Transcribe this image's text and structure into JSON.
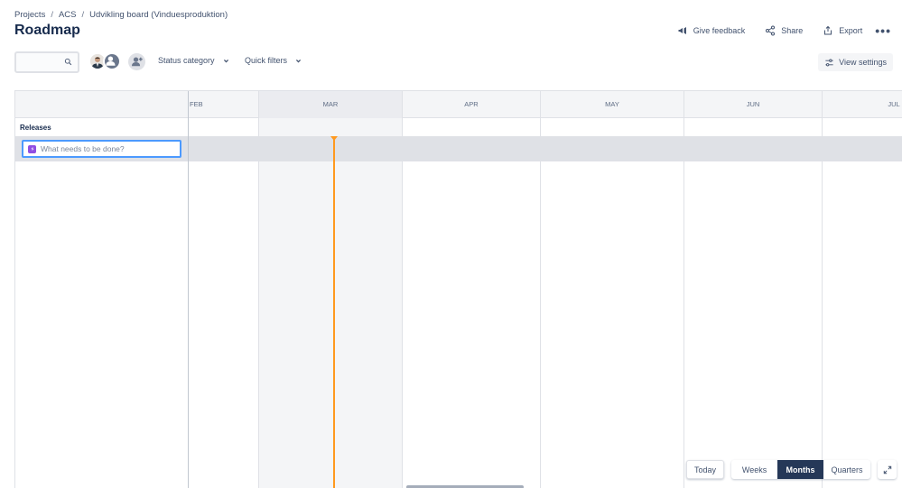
{
  "breadcrumb": {
    "items": [
      "Projects",
      "ACS",
      "Udvikling board (Vinduesproduktion)"
    ],
    "separator": "/"
  },
  "page": {
    "title": "Roadmap"
  },
  "top_actions": {
    "feedback": "Give feedback",
    "share": "Share",
    "export": "Export",
    "more": "•••"
  },
  "toolbar": {
    "search_value": "",
    "status_category": "Status category",
    "quick_filters": "Quick filters",
    "view_settings": "View settings"
  },
  "timeline": {
    "months": [
      "FEB",
      "MAR",
      "APR",
      "MAY",
      "JUN",
      "JUL"
    ],
    "current_month": "MAR"
  },
  "releases": {
    "label": "Releases"
  },
  "new_item": {
    "placeholder": "What needs to be done?"
  },
  "zoom": {
    "today": "Today",
    "weeks": "Weeks",
    "months": "Months",
    "quarters": "Quarters",
    "selected": "Months"
  },
  "colors": {
    "today_line": "#ff991f",
    "selected_zoom": "#253858",
    "focus_border": "#4c9aff",
    "epic_icon": "#904ee2"
  }
}
